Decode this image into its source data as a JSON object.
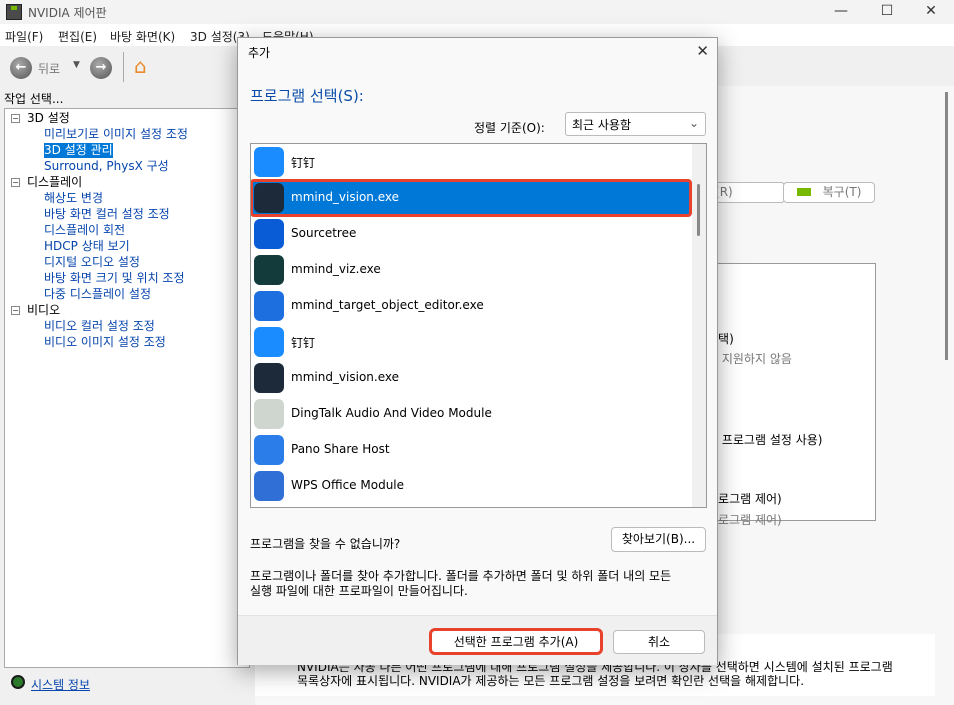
{
  "window": {
    "title": "NVIDIA 제어판",
    "controls": [
      "—",
      "☐",
      "✕"
    ]
  },
  "menu": [
    "파일(F)",
    "편집(E)",
    "바탕 화면(K)",
    "3D 설정(3)",
    "도움말(H)"
  ],
  "toolbar": {
    "back": "뒤로"
  },
  "left": {
    "header": "작업 선택...",
    "tree": [
      {
        "label": "3D 설정",
        "type": "cat"
      },
      {
        "label": "미리보기로 이미지 설정 조정",
        "type": "leaf"
      },
      {
        "label": "3D 설정 관리",
        "type": "leaf",
        "selected": true
      },
      {
        "label": "Surround, PhysX 구성",
        "type": "leaf"
      },
      {
        "label": "디스플레이",
        "type": "cat"
      },
      {
        "label": "해상도 변경",
        "type": "leaf"
      },
      {
        "label": "바탕 화면 컬러 설정 조정",
        "type": "leaf"
      },
      {
        "label": "디스플레이 회전",
        "type": "leaf"
      },
      {
        "label": "HDCP 상태 보기",
        "type": "leaf"
      },
      {
        "label": "디지털 오디오 설정",
        "type": "leaf"
      },
      {
        "label": "바탕 화면 크기 및 위치 조정",
        "type": "leaf"
      },
      {
        "label": "다중 디스플레이 설정",
        "type": "leaf"
      },
      {
        "label": "비디오",
        "type": "cat"
      },
      {
        "label": "비디오 컬러 설정 조정",
        "type": "leaf"
      },
      {
        "label": "비디오 이미지 설정 조정",
        "type": "leaf"
      }
    ],
    "system_info": "시스템 정보"
  },
  "right": {
    "remove_btn": "거(R)",
    "restore_btn": "복구(T)",
    "lines": [
      "선택)",
      "해 지원하지 않음",
      "용 프로그램 설정 사용)",
      "프로그램 제어)",
      "프로그램 제어)"
    ],
    "footer_line1": "NVIDIA는 자동 다른 어떤 프로그램에 대해 프로그램 설정을 제공합니다. 이 상자를 선택하면 시스템에 설치된 프로그램",
    "footer_line2": "목록상자에 표시됩니다. NVIDIA가 제공하는 모든 프로그램 설정을 보려면 확인란 선택을 해제합니다."
  },
  "dialog": {
    "title": "추가",
    "heading": "프로그램 선택(S):",
    "sort_label": "정렬 기준(O):",
    "sort_value": "최근 사용함",
    "items": [
      {
        "name": "钉钉",
        "icon": "dingtalk-icon",
        "color": "#1a8cff"
      },
      {
        "name": "mmind_vision.exe",
        "icon": "mmind-vision-icon",
        "color": "#1c2a3a",
        "selected": true
      },
      {
        "name": "Sourcetree",
        "icon": "sourcetree-icon",
        "color": "#0a5cd6"
      },
      {
        "name": "mmind_viz.exe",
        "icon": "mmind-viz-icon",
        "color": "#143b3b"
      },
      {
        "name": "mmind_target_object_editor.exe",
        "icon": "target-editor-icon",
        "color": "#1d6fe0"
      },
      {
        "name": "钉钉",
        "icon": "dingtalk-icon",
        "color": "#1a8cff"
      },
      {
        "name": "mmind_vision.exe",
        "icon": "mmind-vision-icon",
        "color": "#1c2a3a"
      },
      {
        "name": "DingTalk Audio And Video Module",
        "icon": "window-icon",
        "color": "#cfd6cf"
      },
      {
        "name": "Pano Share Host",
        "icon": "pano-share-icon",
        "color": "#2b7de9"
      },
      {
        "name": "WPS Office Module",
        "icon": "tools-icon",
        "color": "#2f6fd6"
      }
    ],
    "not_found": "프로그램을 찾을 수 없습니까?",
    "browse": "찾아보기(B)...",
    "desc1": "프로그램이나 폴더를 찾아 추가합니다. 폴더를 추가하면 폴더 및 하위 폴더 내의 모든",
    "desc2": "실행 파일에 대한 프로파일이 만들어집니다.",
    "add": "선택한 프로그램 추가(A)",
    "cancel": "취소"
  },
  "colors": {
    "accent": "#0078d7",
    "highlight": "#e8412c",
    "heading": "#0a4da8"
  }
}
